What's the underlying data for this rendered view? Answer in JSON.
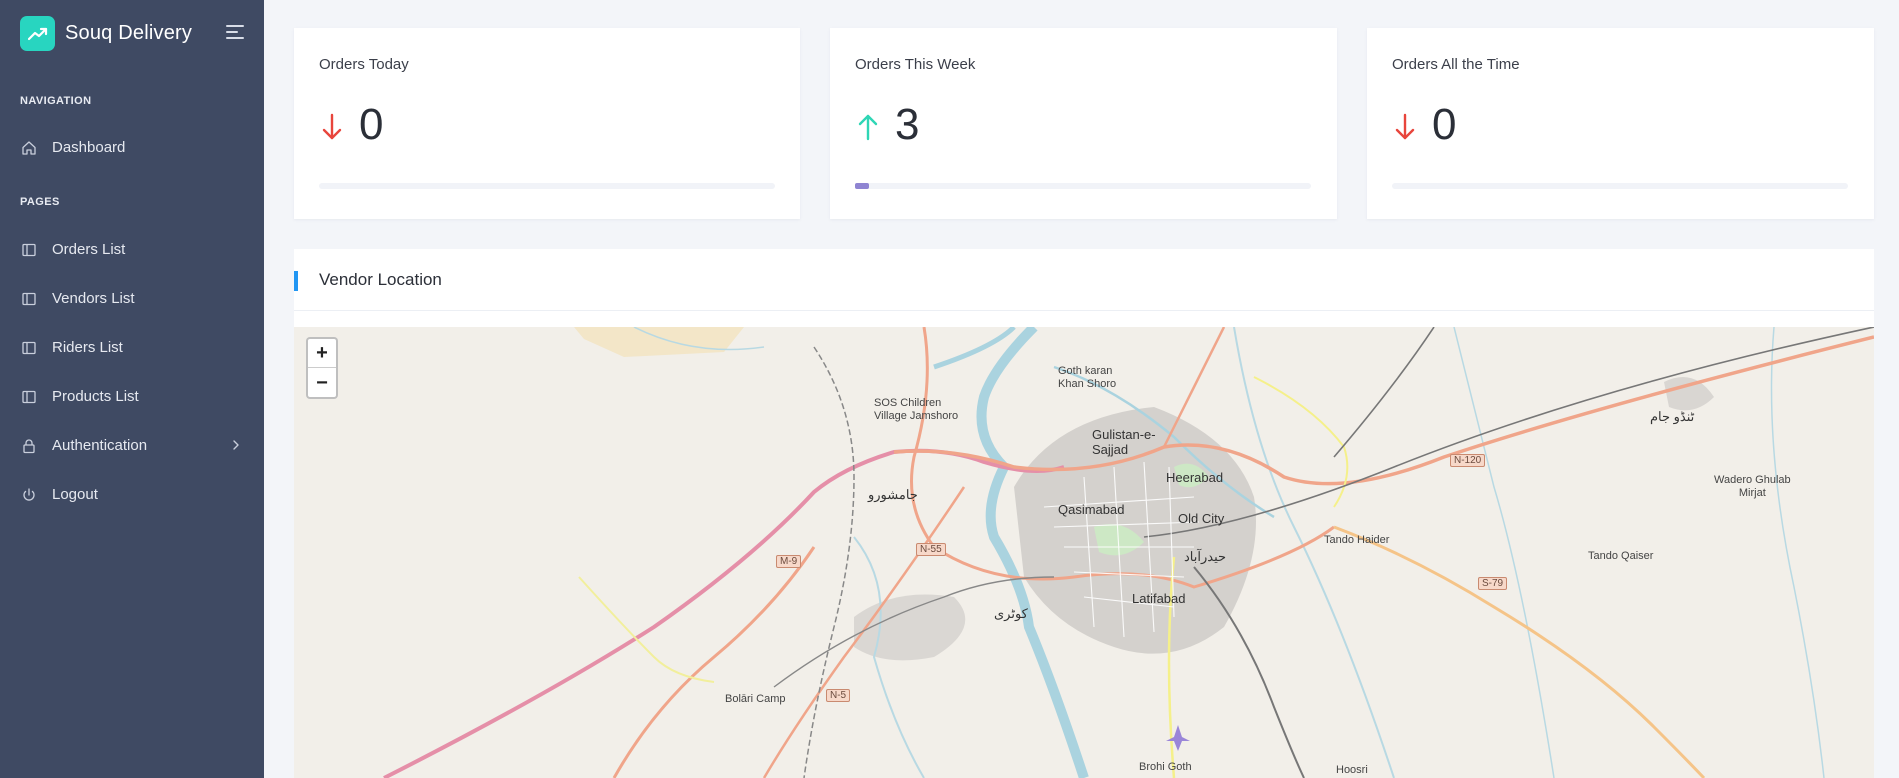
{
  "sidebar": {
    "brand_name": "Souq Delivery",
    "sections": [
      {
        "label": "NAVIGATION"
      },
      {
        "label": "PAGES"
      }
    ],
    "items": [
      {
        "label": "Dashboard",
        "icon": "home-icon"
      },
      {
        "label": "Orders List",
        "icon": "sidebar-panel-icon"
      },
      {
        "label": "Vendors List",
        "icon": "sidebar-panel-icon"
      },
      {
        "label": "Riders List",
        "icon": "sidebar-panel-icon"
      },
      {
        "label": "Products List",
        "icon": "sidebar-panel-icon"
      },
      {
        "label": "Authentication",
        "icon": "lock-icon"
      },
      {
        "label": "Logout",
        "icon": "power-icon"
      }
    ]
  },
  "stats": [
    {
      "title": "Orders Today",
      "value": "0",
      "trend": "down",
      "progress": 0
    },
    {
      "title": "Orders This Week",
      "value": "3",
      "trend": "up",
      "progress": 0.03
    },
    {
      "title": "Orders All the Time",
      "value": "0",
      "trend": "down",
      "progress": 0
    }
  ],
  "colors": {
    "sidebar_bg": "#3f4a63",
    "brand_accent": "#28d5c0",
    "trend_down": "#e8453c",
    "trend_up": "#2fd6b5",
    "progress_fill": "#8f84d2",
    "panel_accent": "#2196f3"
  },
  "vendor_map": {
    "title": "Vendor Location",
    "zoom_in": "+",
    "zoom_out": "−",
    "labels": [
      "Goth karan\nKhan Shoro",
      "SOS Children\nVillage Jamshoro",
      "Gulistan-e-\nSajjad",
      "Heerabad",
      "جامشورو",
      "Qasimabad",
      "Old City",
      "حیدرآباد",
      "Latifabad",
      "کوٹری",
      "Tando Haider",
      "Tando Qaiser",
      "Wadero Ghulab\nMirjat",
      "ٹنڈو جام",
      "Bolāri Camp",
      "Brohi Goth",
      "Hoosri"
    ],
    "road_shields": [
      "M-9",
      "N-55",
      "N-5",
      "N-120",
      "S-79"
    ]
  }
}
